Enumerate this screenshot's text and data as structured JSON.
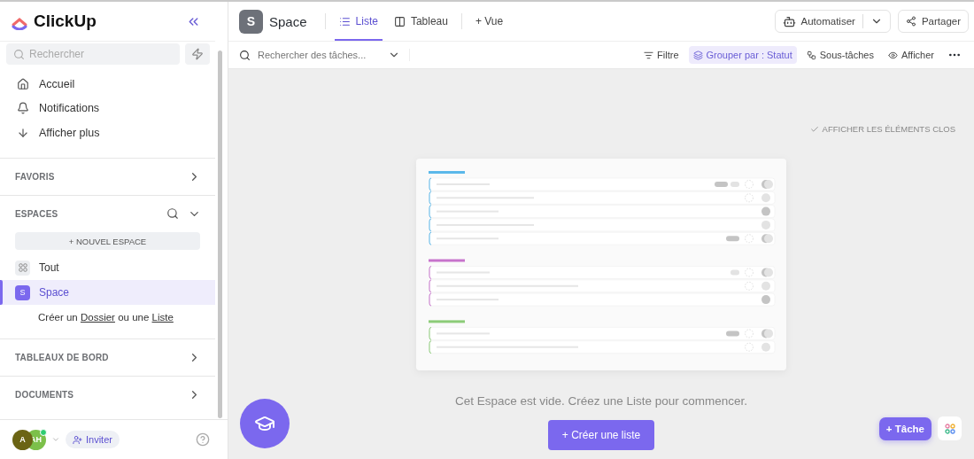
{
  "sidebar": {
    "logo": "ClickUp",
    "search": {
      "placeholder": "Rechercher"
    },
    "nav": [
      {
        "label": "Accueil"
      },
      {
        "label": "Notifications"
      },
      {
        "label": "Afficher plus"
      }
    ],
    "sections": [
      {
        "title": "FAVORIS",
        "expanded": false
      },
      {
        "title": "ESPACES",
        "expanded": true,
        "new_button": "+ NOUVEL ESPACE",
        "items": [
          {
            "label": "Tout",
            "kind": "all",
            "selected": false
          },
          {
            "label": "Space",
            "kind": "space",
            "badge": "S",
            "selected": true
          }
        ],
        "hint": {
          "before": "Créer un",
          "link_1": "Dossier",
          "middle": "ou une",
          "link_2": "Liste"
        }
      },
      {
        "title": "TABLEAUX DE BORD",
        "expanded": false
      },
      {
        "title": "DOCUMENTS",
        "expanded": false
      }
    ],
    "footer": {
      "avatars": [
        {
          "initials": "A",
          "color": "#6b6414",
          "online": false
        },
        {
          "initials": "AH",
          "color": "#7cc04a",
          "online": true
        }
      ],
      "invite": "Inviter"
    }
  },
  "header": {
    "space_badge": "S",
    "title": "Space",
    "tabs": [
      {
        "label": "Liste",
        "selected": true
      },
      {
        "label": "Tableau",
        "selected": false
      }
    ],
    "add_view": "+ Vue",
    "automate": "Automatiser",
    "share": "Partager"
  },
  "toolbar": {
    "search": {
      "placeholder": "Rechercher des tâches..."
    },
    "buttons": [
      {
        "label": "Filtre",
        "active": false
      },
      {
        "label": "Grouper par : Statut",
        "active": true
      },
      {
        "label": "Sous-tâches",
        "active": false
      },
      {
        "label": "Afficher",
        "active": false
      }
    ]
  },
  "content": {
    "show_closed": "AFFICHER LES ÉLÉMENTS CLOS",
    "empty_message": "Cet Espace est vide. Créez une Liste pour commencer.",
    "create_button": "+ Créer une liste",
    "task_button": "+ Tâche"
  }
}
